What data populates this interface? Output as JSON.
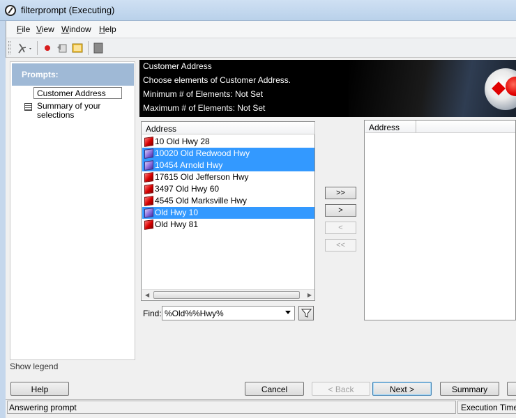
{
  "window": {
    "title": "filterprompt (Executing)"
  },
  "menu": [
    {
      "label": "File",
      "key": "F",
      "rest": "ile"
    },
    {
      "label": "View",
      "key": "V",
      "rest": "iew"
    },
    {
      "label": "Window",
      "key": "W",
      "rest": "indow"
    },
    {
      "label": "Help",
      "key": "H",
      "rest": "elp"
    }
  ],
  "sidebar": {
    "header": "Prompts:",
    "items": [
      {
        "label": "Customer Address"
      },
      {
        "label": "Summary of your selections"
      }
    ],
    "show_legend": "Show legend"
  },
  "prompt": {
    "name": "Customer Address",
    "description": "Choose elements of Customer Address.",
    "min": "Minimum # of Elements: Not Set",
    "max": "Maximum # of Elements: Not Set"
  },
  "available": {
    "column": "Address",
    "items": [
      {
        "text": "10 Old Hwy 28",
        "selected": false
      },
      {
        "text": "10020 Old Redwood Hwy",
        "selected": true
      },
      {
        "text": "10454 Arnold Hwy",
        "selected": true
      },
      {
        "text": "17615 Old Jefferson Hwy",
        "selected": false
      },
      {
        "text": "3497 Old Hwy 60",
        "selected": false
      },
      {
        "text": "4545 Old Marksville Hwy",
        "selected": false
      },
      {
        "text": "Old Hwy 10",
        "selected": true
      },
      {
        "text": "Old Hwy 81",
        "selected": false
      }
    ]
  },
  "find": {
    "label": "Find:",
    "value": "%Old%%Hwy%"
  },
  "transfer": {
    "add_all": ">>",
    "add": ">",
    "remove": "<",
    "remove_all": "<<"
  },
  "selected": {
    "column": "Address"
  },
  "buttons": {
    "help": "Help",
    "cancel": "Cancel",
    "back": "< Back",
    "next": "Next >",
    "summary": "Summary"
  },
  "status": {
    "left": "Answering prompt",
    "right": "Execution Time"
  },
  "colors": {
    "selection": "#3399ff",
    "prompts_header": "#9fb9d6",
    "banner": "#000000"
  }
}
